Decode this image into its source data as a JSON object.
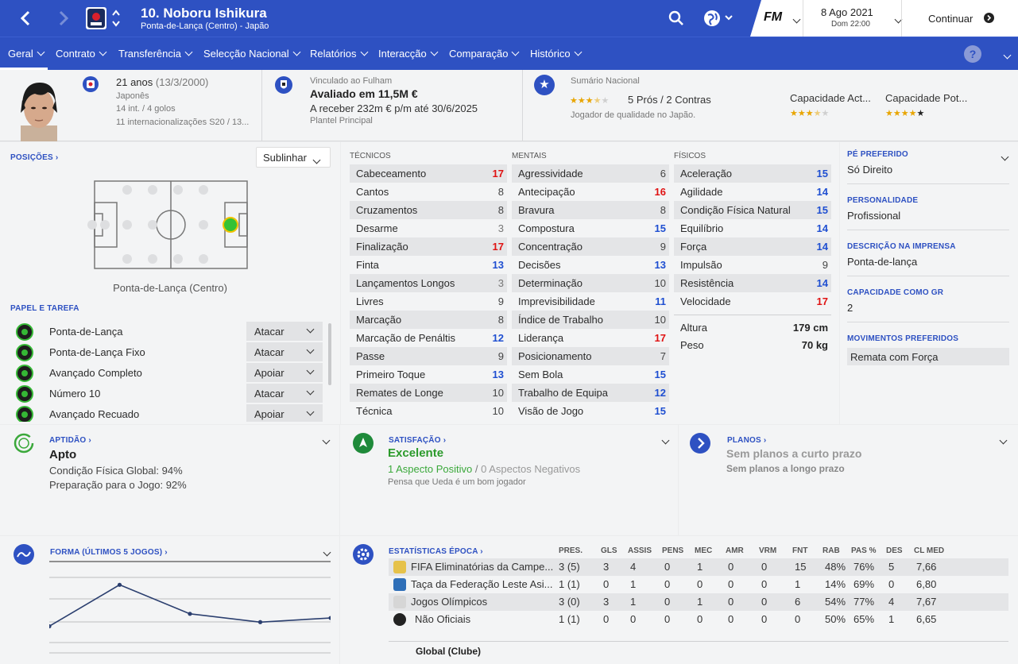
{
  "header": {
    "player_title": "10. Noboru Ishikura",
    "player_subtitle": "Ponta-de-Lança (Centro) - Japão",
    "date": "8 Ago 2021",
    "time": "Dom 22:00",
    "continue_label": "Continuar",
    "fm_logo": "FM"
  },
  "nav": {
    "items": [
      "Geral",
      "Contrato",
      "Transferência",
      "Selecção Nacional",
      "Relatórios",
      "Interacção",
      "Comparação",
      "Histórico"
    ]
  },
  "profile": {
    "age": "21 anos",
    "dob": "(13/3/2000)",
    "nationality": "Japonês",
    "caps": "14 int. / 4 golos",
    "youth_caps": "11 internacionalizações S20 / 13..."
  },
  "contract": {
    "club": "Vinculado ao Fulham",
    "value": "Avaliado em 11,5M €",
    "wage": "A receber 232m € p/m até 30/6/2025",
    "squad": "Plantel Principal"
  },
  "summary": {
    "label": "Sumário Nacional",
    "pros_cons": "5 Prós / 2 Contras",
    "desc": "Jogador de qualidade no Japão.",
    "current_ability_label": "Capacidade Act...",
    "potential_ability_label": "Capacidade Pot...",
    "summary_stars": 3.5,
    "current_stars": 3.5,
    "potential_stars": 5
  },
  "positions": {
    "label": "POSIÇÕES",
    "highlight_label": "Sublinhar",
    "position_caption": "Ponta-de-Lança (Centro)",
    "role_label": "PAPEL E TAREFA",
    "roles": [
      {
        "name": "Ponta-de-Lança",
        "duty": "Atacar"
      },
      {
        "name": "Ponta-de-Lança Fixo",
        "duty": "Atacar"
      },
      {
        "name": "Avançado Completo",
        "duty": "Apoiar"
      },
      {
        "name": "Número 10",
        "duty": "Atacar"
      },
      {
        "name": "Avançado Recuado",
        "duty": "Apoiar"
      }
    ]
  },
  "attributes": {
    "technical_label": "TÉCNICOS",
    "mental_label": "MENTAIS",
    "physical_label": "FÍSICOS",
    "technical": [
      {
        "name": "Cabeceamento",
        "value": "17"
      },
      {
        "name": "Cantos",
        "value": "8"
      },
      {
        "name": "Cruzamentos",
        "value": "8"
      },
      {
        "name": "Desarme",
        "value": "3"
      },
      {
        "name": "Finalização",
        "value": "17"
      },
      {
        "name": "Finta",
        "value": "13"
      },
      {
        "name": "Lançamentos Longos",
        "value": "3"
      },
      {
        "name": "Livres",
        "value": "9"
      },
      {
        "name": "Marcação",
        "value": "8"
      },
      {
        "name": "Marcação de Penáltis",
        "value": "12"
      },
      {
        "name": "Passe",
        "value": "9"
      },
      {
        "name": "Primeiro Toque",
        "value": "13"
      },
      {
        "name": "Remates de Longe",
        "value": "10"
      },
      {
        "name": "Técnica",
        "value": "10"
      }
    ],
    "mental": [
      {
        "name": "Agressividade",
        "value": "6"
      },
      {
        "name": "Antecipação",
        "value": "16"
      },
      {
        "name": "Bravura",
        "value": "8"
      },
      {
        "name": "Compostura",
        "value": "15"
      },
      {
        "name": "Concentração",
        "value": "9"
      },
      {
        "name": "Decisões",
        "value": "13"
      },
      {
        "name": "Determinação",
        "value": "10"
      },
      {
        "name": "Imprevisibilidade",
        "value": "11"
      },
      {
        "name": "Índice de Trabalho",
        "value": "10"
      },
      {
        "name": "Liderança",
        "value": "17"
      },
      {
        "name": "Posicionamento",
        "value": "7"
      },
      {
        "name": "Sem Bola",
        "value": "15"
      },
      {
        "name": "Trabalho de Equipa",
        "value": "12"
      },
      {
        "name": "Visão de Jogo",
        "value": "15"
      }
    ],
    "physical": [
      {
        "name": "Aceleração",
        "value": "15"
      },
      {
        "name": "Agilidade",
        "value": "14"
      },
      {
        "name": "Condição Física Natural",
        "value": "15"
      },
      {
        "name": "Equilíbrio",
        "value": "14"
      },
      {
        "name": "Força",
        "value": "14"
      },
      {
        "name": "Impulsão",
        "value": "9"
      },
      {
        "name": "Resistência",
        "value": "14"
      },
      {
        "name": "Velocidade",
        "value": "17"
      }
    ],
    "height_label": "Altura",
    "height": "179 cm",
    "weight_label": "Peso",
    "weight": "70 kg"
  },
  "info": {
    "preferred_foot_label": "PÉ PREFERIDO",
    "preferred_foot": "Só Direito",
    "personality_label": "PERSONALIDADE",
    "personality": "Profissional",
    "press_label": "DESCRIÇÃO NA IMPRENSA",
    "press": "Ponta-de-lança",
    "gk_label": "CAPACIDADE COMO GR",
    "gk": "2",
    "moves_label": "MOVIMENTOS PREFERIDOS",
    "moves": "Remata com Força"
  },
  "fitness": {
    "label": "APTIDÃO",
    "status": "Apto",
    "condition": "Condição Física Global: 94%",
    "match_prep": "Preparação para o Jogo: 92%"
  },
  "happiness": {
    "label": "SATISFAÇÃO",
    "status": "Excelente",
    "positive": "1 Aspecto Positivo",
    "separator": "/",
    "negative": "0 Aspectos Negativos",
    "note": "Pensa que Ueda é um bom jogador"
  },
  "plans": {
    "label": "PLANOS",
    "short": "Sem planos a curto prazo",
    "long": "Sem planos a longo prazo"
  },
  "form": {
    "label": "FORMA (ÚLTIMOS 5 JOGOS)",
    "ratings": [
      6.2,
      7.2,
      6.5,
      6.3,
      6.4
    ]
  },
  "season_stats": {
    "label": "ESTATÍSTICAS ÉPOCA",
    "columns": [
      "PRES.",
      "GLS",
      "ASSIS",
      "PENS",
      "MEC",
      "AMR",
      "VRM",
      "FNT",
      "RAB",
      "PAS %",
      "DES",
      "CL MED"
    ],
    "rows": [
      {
        "comp": "FIFA Eliminatórias da Campe...",
        "vals": [
          "3 (5)",
          "3",
          "4",
          "0",
          "1",
          "0",
          "0",
          "15",
          "48%",
          "76%",
          "5",
          "7,66"
        ]
      },
      {
        "comp": "Taça da Federação Leste Asi...",
        "vals": [
          "1 (1)",
          "0",
          "1",
          "0",
          "0",
          "0",
          "0",
          "1",
          "14%",
          "69%",
          "0",
          "6,80"
        ]
      },
      {
        "comp": "Jogos Olímpicos",
        "vals": [
          "3 (0)",
          "3",
          "1",
          "0",
          "1",
          "0",
          "0",
          "6",
          "54%",
          "77%",
          "4",
          "7,67"
        ]
      },
      {
        "comp": "Não Oficiais",
        "vals": [
          "1 (1)",
          "0",
          "0",
          "0",
          "0",
          "0",
          "0",
          "0",
          "50%",
          "65%",
          "1",
          "6,65"
        ]
      }
    ],
    "total_label": "Global (Clube)"
  },
  "colors": {
    "brand": "#2e51c2",
    "high": "#1f4fd1",
    "top": "#e01313",
    "positive": "#3aa83a"
  }
}
